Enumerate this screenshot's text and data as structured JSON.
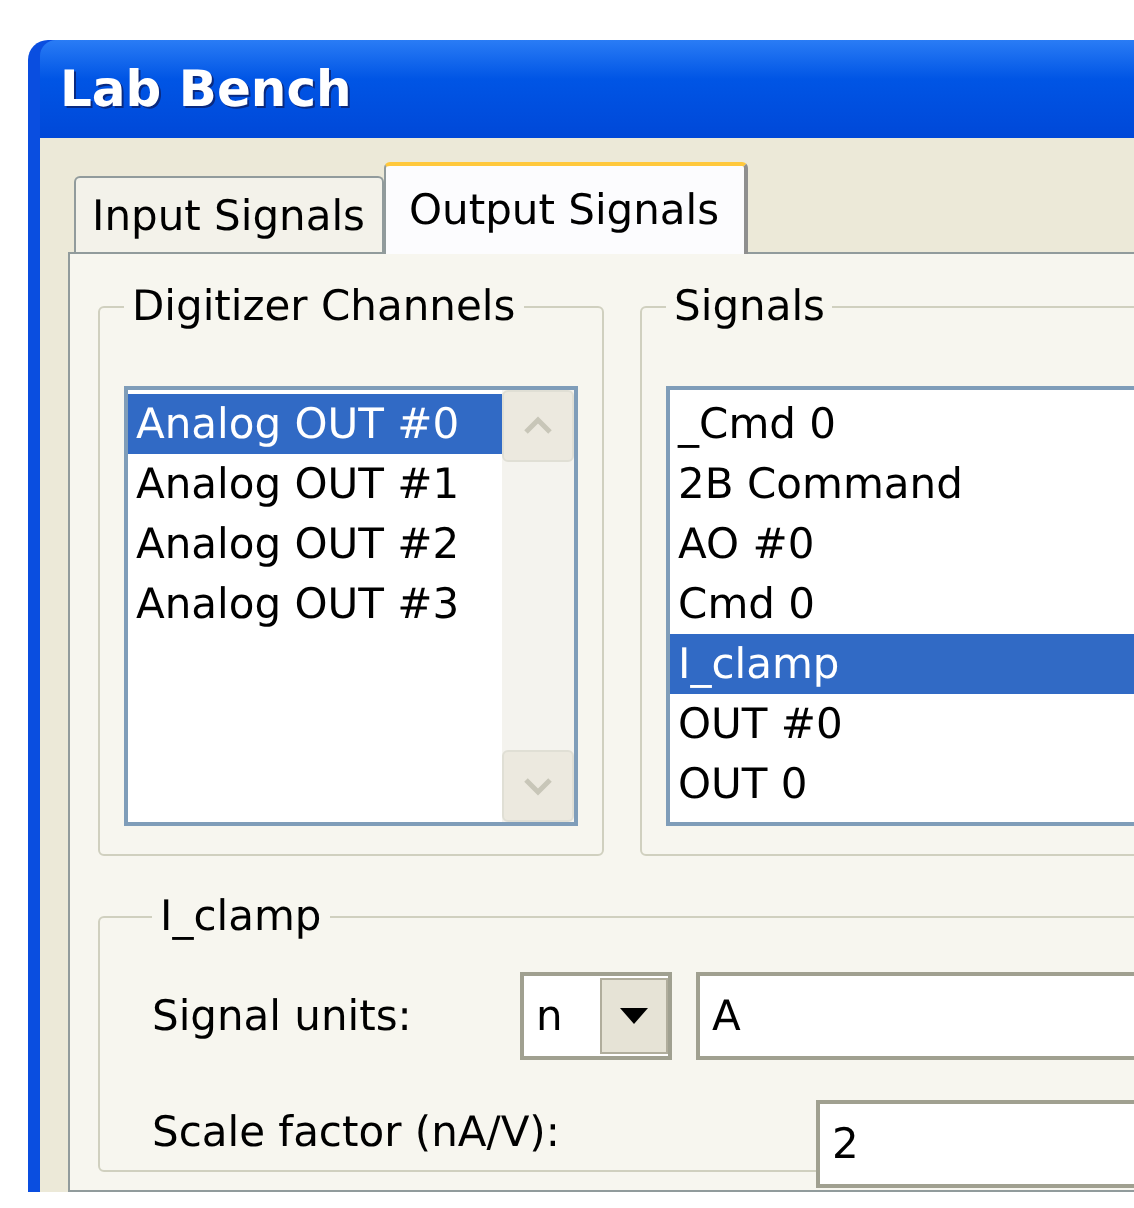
{
  "window": {
    "title": "Lab Bench"
  },
  "tabs": [
    {
      "label": "Input Signals",
      "selected": false
    },
    {
      "label": "Output Signals",
      "selected": true
    }
  ],
  "digitizer_channels": {
    "label": "Digitizer Channels",
    "items": [
      {
        "label": "Analog OUT #0",
        "selected": true
      },
      {
        "label": "Analog OUT #1",
        "selected": false
      },
      {
        "label": "Analog OUT #2",
        "selected": false
      },
      {
        "label": "Analog OUT #3",
        "selected": false
      }
    ]
  },
  "signals": {
    "label": "Signals",
    "items": [
      {
        "label": "_Cmd 0",
        "selected": false
      },
      {
        "label": "2B Command",
        "selected": false
      },
      {
        "label": "AO #0",
        "selected": false
      },
      {
        "label": "Cmd 0",
        "selected": false
      },
      {
        "label": "I_clamp",
        "selected": true
      },
      {
        "label": "OUT #0",
        "selected": false
      },
      {
        "label": "OUT 0",
        "selected": false
      }
    ]
  },
  "signal_settings": {
    "label": "I_clamp",
    "units": {
      "label": "Signal units:",
      "prefix": "n",
      "value": "A"
    },
    "scale": {
      "label": "Scale factor (nA/V):",
      "value": "2"
    }
  }
}
